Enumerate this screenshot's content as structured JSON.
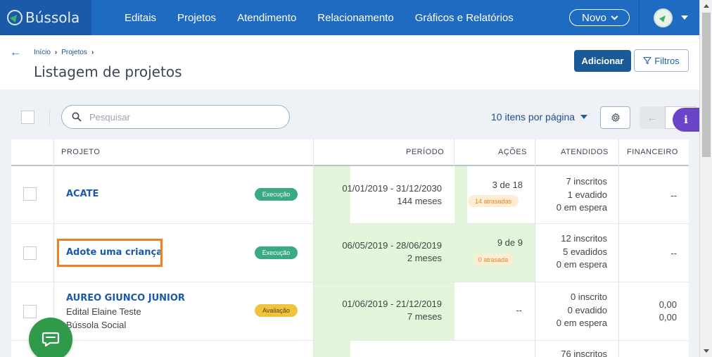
{
  "app": {
    "logo_text": "Bússola"
  },
  "nav": {
    "items": [
      "Editais",
      "Projetos",
      "Atendimento",
      "Relacionamento",
      "Gráficos e Relatórios"
    ],
    "novo_label": "Novo"
  },
  "header": {
    "breadcrumb": [
      "Início",
      "Projetos"
    ],
    "title": "Listagem de projetos",
    "add_label": "Adicionar",
    "filter_label": "Filtros"
  },
  "toolbar": {
    "search_placeholder": "Pesquisar",
    "per_page_label": "10 itens por página",
    "info_label": "i"
  },
  "table": {
    "columns": [
      "PROJETO",
      "PERÍODO",
      "AÇÕES",
      "ATENDIDOS",
      "FINANCEIRO"
    ],
    "rows": [
      {
        "name": "ACATE",
        "subtitle": [],
        "status": "Execução",
        "period": "01/01/2019 - 31/12/2030",
        "duration": "144 meses",
        "acoes": "3 de 18",
        "late": "14 atrasadas",
        "atendidos": [
          "7 inscritos",
          "1 evadido",
          "0 em espera"
        ],
        "financeiro": [
          "--"
        ]
      },
      {
        "name": "Adote uma criança",
        "subtitle": [],
        "status": "Execução",
        "period": "06/05/2019 - 28/06/2019",
        "duration": "2 meses",
        "acoes": "9 de 9",
        "late": "0 atrasada",
        "atendidos": [
          "12 inscritos",
          "5 evadidos",
          "0 em espera"
        ],
        "financeiro": [
          "--"
        ]
      },
      {
        "name": "AUREO GIUNCO JUNIOR",
        "subtitle": [
          "Edital Elaine Teste",
          "Bússola Social"
        ],
        "status": "Avaliação",
        "period": "01/06/2019 - 21/12/2019",
        "duration": "7 meses",
        "acoes": "--",
        "late": "",
        "atendidos": [
          "0 inscrito",
          "0 evadido",
          "0 em espera"
        ],
        "financeiro": [
          "0,00",
          "0,00"
        ]
      },
      {
        "name": "",
        "subtitle": [],
        "status": "",
        "period": "",
        "duration": "",
        "acoes": "",
        "late": "",
        "atendidos": [
          "76 inscritos"
        ],
        "financeiro": []
      }
    ]
  }
}
